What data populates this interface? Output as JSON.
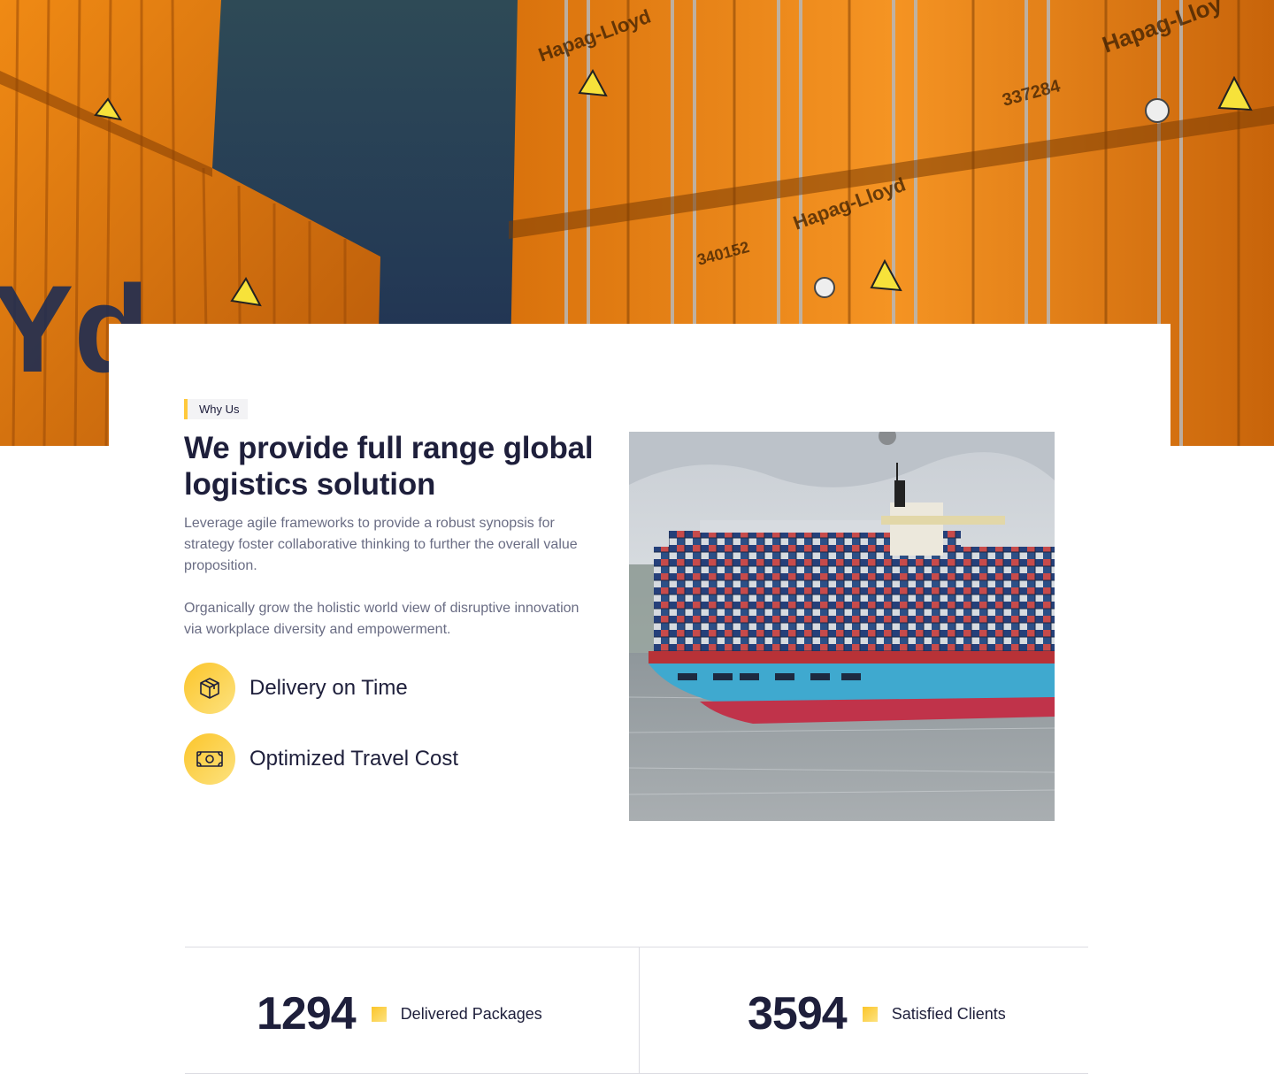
{
  "why_us": {
    "tag": "Why Us",
    "title": "We provide full range global logistics solution",
    "paragraph_1": "Leverage agile frameworks to provide a robust synopsis for strategy foster collaborative thinking to further the overall value proposition.",
    "paragraph_2": "Organically grow the holistic world view of disruptive innovation via workplace diversity and empowerment.",
    "features": [
      {
        "label": "Delivery on Time",
        "icon": "box-icon"
      },
      {
        "label": "Optimized Travel Cost",
        "icon": "money-icon"
      }
    ]
  },
  "stats": [
    {
      "value": "1294",
      "label": "Delivered Packages"
    },
    {
      "value": "3594",
      "label": "Satisfied Clients"
    }
  ],
  "colors": {
    "accent": "#fbc52a",
    "heading": "#1e1f3b",
    "body_text": "#6a6d84",
    "container_orange": "#e07a10",
    "hero_navy": "#243a55"
  }
}
